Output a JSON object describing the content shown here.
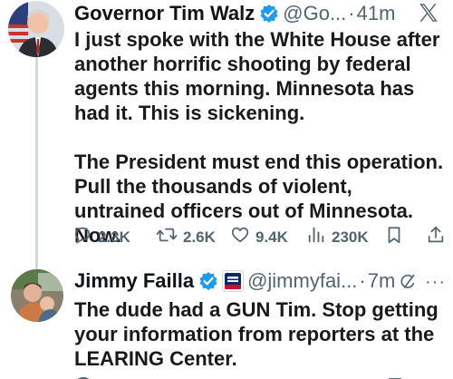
{
  "tweets": [
    {
      "display_name": "Governor Tim Walz",
      "handle": "@Go...",
      "separator": "·",
      "time": "41m",
      "text": "I just spoke with the White House after another horrific shooting by federal agents this morning. Minnesota has had it. This is sickening.\n\nThe President must end this operation. Pull the thousands of violent, untrained officers out of Minnesota. Now.",
      "stats": {
        "replies": "2.3K",
        "reposts": "2.6K",
        "likes": "9.4K",
        "views": "230K"
      }
    },
    {
      "display_name": "Jimmy Failla",
      "handle": "@jimmyfai...",
      "separator": "·",
      "time": "7m",
      "text": "The dude had a GUN Tim. Stop getting your information from reporters at the LEARING Center.",
      "more": "···"
    }
  ],
  "colors": {
    "text": "#0f1419",
    "secondary": "#536471",
    "verified_blue": "#1d9bf0",
    "thread_line": "#cfd9de"
  },
  "icons": [
    "verified-badge-icon",
    "x-logo-icon",
    "reply-icon",
    "repost-icon",
    "like-icon",
    "views-icon",
    "bookmark-icon",
    "share-icon",
    "fox-news-affiliate-icon",
    "grok-icon",
    "more-icon"
  ]
}
